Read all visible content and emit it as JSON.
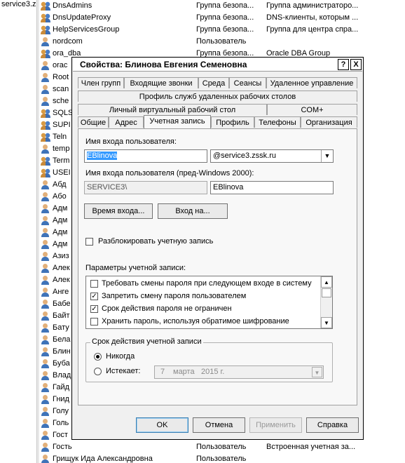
{
  "tree": {
    "node_label": "service3.z"
  },
  "list_rows": [
    {
      "icon": "group-icon",
      "name": "DnsAdmins",
      "type": "Группа безопа...",
      "desc": "Группа администраторо..."
    },
    {
      "icon": "group-icon",
      "name": "DnsUpdateProxy",
      "type": "Группа безопа...",
      "desc": "DNS-клиенты, которым ..."
    },
    {
      "icon": "group-icon",
      "name": "HelpServicesGroup",
      "type": "Группа безопа...",
      "desc": "Группа для центра спра..."
    },
    {
      "icon": "user-icon",
      "name": "nordcom",
      "type": "Пользователь",
      "desc": ""
    },
    {
      "icon": "group-icon",
      "name": "ora_dba",
      "type": "Группа безопа...",
      "desc": "Oracle DBA Group"
    },
    {
      "icon": "user-icon",
      "name": "orac",
      "type": "",
      "desc": ""
    },
    {
      "icon": "user-icon",
      "name": "Root",
      "type": "",
      "desc": ""
    },
    {
      "icon": "user-icon",
      "name": "scan",
      "type": "",
      "desc": ""
    },
    {
      "icon": "user-icon",
      "name": "sche",
      "type": "",
      "desc": ""
    },
    {
      "icon": "group-icon",
      "name": "SQLS",
      "type": "",
      "desc": ""
    },
    {
      "icon": "group-icon",
      "name": "SUPI",
      "type": "",
      "desc": ""
    },
    {
      "icon": "group-icon",
      "name": "Teln",
      "type": "",
      "desc": ""
    },
    {
      "icon": "user-icon",
      "name": "temp",
      "type": "",
      "desc": ""
    },
    {
      "icon": "group-icon",
      "name": "Term",
      "type": "",
      "desc": ""
    },
    {
      "icon": "group-icon",
      "name": "USEI",
      "type": "",
      "desc": ""
    },
    {
      "icon": "user-icon",
      "name": "Абд",
      "type": "",
      "desc": ""
    },
    {
      "icon": "user-icon",
      "name": "Або",
      "type": "",
      "desc": ""
    },
    {
      "icon": "user-icon",
      "name": "Адм",
      "type": "",
      "desc": ""
    },
    {
      "icon": "user-icon",
      "name": "Адм",
      "type": "",
      "desc": ""
    },
    {
      "icon": "user-icon",
      "name": "Адм",
      "type": "",
      "desc": ""
    },
    {
      "icon": "user-icon",
      "name": "Адм",
      "type": "",
      "desc": ""
    },
    {
      "icon": "user-icon",
      "name": "Азиз",
      "type": "",
      "desc": ""
    },
    {
      "icon": "user-icon",
      "name": "Алек",
      "type": "",
      "desc": ""
    },
    {
      "icon": "user-icon",
      "name": "Алек",
      "type": "",
      "desc": ""
    },
    {
      "icon": "user-icon",
      "name": "Анге",
      "type": "",
      "desc": ""
    },
    {
      "icon": "user-icon",
      "name": "Бабе",
      "type": "",
      "desc": ""
    },
    {
      "icon": "user-icon",
      "name": "Байт",
      "type": "",
      "desc": ""
    },
    {
      "icon": "user-icon",
      "name": "Бату",
      "type": "",
      "desc": ""
    },
    {
      "icon": "user-icon",
      "name": "Бела",
      "type": "",
      "desc": ""
    },
    {
      "icon": "user-icon",
      "name": "Блин",
      "type": "",
      "desc": ""
    },
    {
      "icon": "user-icon",
      "name": "Буба",
      "type": "",
      "desc": ""
    },
    {
      "icon": "user-icon",
      "name": "Влад",
      "type": "",
      "desc": ""
    },
    {
      "icon": "user-icon",
      "name": "Гайд",
      "type": "",
      "desc": ""
    },
    {
      "icon": "user-icon",
      "name": "Гнид",
      "type": "",
      "desc": ""
    },
    {
      "icon": "user-icon",
      "name": "Голу",
      "type": "",
      "desc": ""
    },
    {
      "icon": "user-icon",
      "name": "Голь",
      "type": "",
      "desc": ""
    },
    {
      "icon": "user-icon",
      "name": "Гост",
      "type": "",
      "desc": ""
    },
    {
      "icon": "user-icon",
      "name": "Гость",
      "type": "Пользователь",
      "desc": "Встроенная учетная за..."
    },
    {
      "icon": "user-icon",
      "name": "Грищук Ида Александровна",
      "type": "Пользователь",
      "desc": ""
    }
  ],
  "dialog": {
    "title": "Свойства: Блинова Евгения Семеновна",
    "help_btn": "?",
    "close_btn": "X",
    "tabs_row1": [
      "Член групп",
      "Входящие звонки",
      "Среда",
      "Сеансы",
      "Удаленное управление"
    ],
    "tabs_row2": [
      "Профиль служб удаленных рабочих столов"
    ],
    "tabs_row3": [
      "Личный виртуальный рабочий стол",
      "COM+"
    ],
    "tabs_row4": [
      "Общие",
      "Адрес",
      "Учетная запись",
      "Профиль",
      "Телефоны",
      "Организация"
    ],
    "logon_name_label": "Имя входа пользователя:",
    "logon_name": "EBlinova",
    "domain_suffix": "@service3.zssk.ru",
    "pre2000_label": "Имя входа пользователя (пред-Windows 2000):",
    "pre2000_domain": "SERVICE3\\",
    "pre2000_name": "EBlinova",
    "logon_hours_btn": "Время входа...",
    "logon_to_btn": "Вход на...",
    "unlock_label": "Разблокировать учетную запись",
    "account_options_label": "Параметры учетной записи:",
    "options": [
      {
        "label": "Требовать смены пароля при следующем входе в систему",
        "checked": false
      },
      {
        "label": "Запретить смену пароля пользователем",
        "checked": true
      },
      {
        "label": "Срок действия пароля не ограничен",
        "checked": true
      },
      {
        "label": "Хранить пароль, используя обратимое шифрование",
        "checked": false
      }
    ],
    "expires_group_label": "Срок действия учетной записи",
    "never_label": "Никогда",
    "never_selected": true,
    "end_of_label": "Истекает:",
    "date_day": "7",
    "date_month": "марта",
    "date_year": "2015 г.",
    "ok_btn": "OK",
    "cancel_btn": "Отмена",
    "apply_btn": "Применить",
    "help_button": "Справка"
  }
}
